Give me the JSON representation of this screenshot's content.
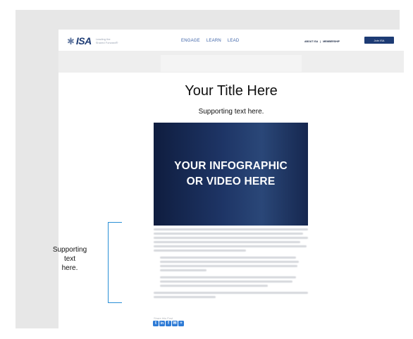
{
  "header": {
    "logo_mark": "✱",
    "logo_text": "ISA",
    "logo_tagline": "Leading the Shared Forward®",
    "nav": [
      "ENGAGE",
      "LEARN",
      "LEAD"
    ],
    "secondary_nav": [
      "ABOUT ISA",
      "|",
      "MEMBERSHIP"
    ],
    "join_label": "Join ISA"
  },
  "main": {
    "title": "Your Title Here",
    "subtitle": "Supporting text here.",
    "infographic_line1": "YOUR INFOGRAPHIC",
    "infographic_line2": "OR VIDEO HERE"
  },
  "share": {
    "label": "Share this Post",
    "icons": [
      "twitter-icon",
      "linkedin-icon",
      "facebook-icon",
      "email-icon",
      "plus-icon"
    ],
    "glyphs": [
      "t",
      "in",
      "f",
      "✉",
      "+"
    ],
    "color": "#2e7bd6"
  },
  "annotation": {
    "line1": "Supporting",
    "line2": "text",
    "line3": "here.",
    "bracket_color": "#2a8fd6"
  },
  "colors": {
    "brand_navy": "#1d3b74",
    "nav_blue": "#3d63a8"
  }
}
